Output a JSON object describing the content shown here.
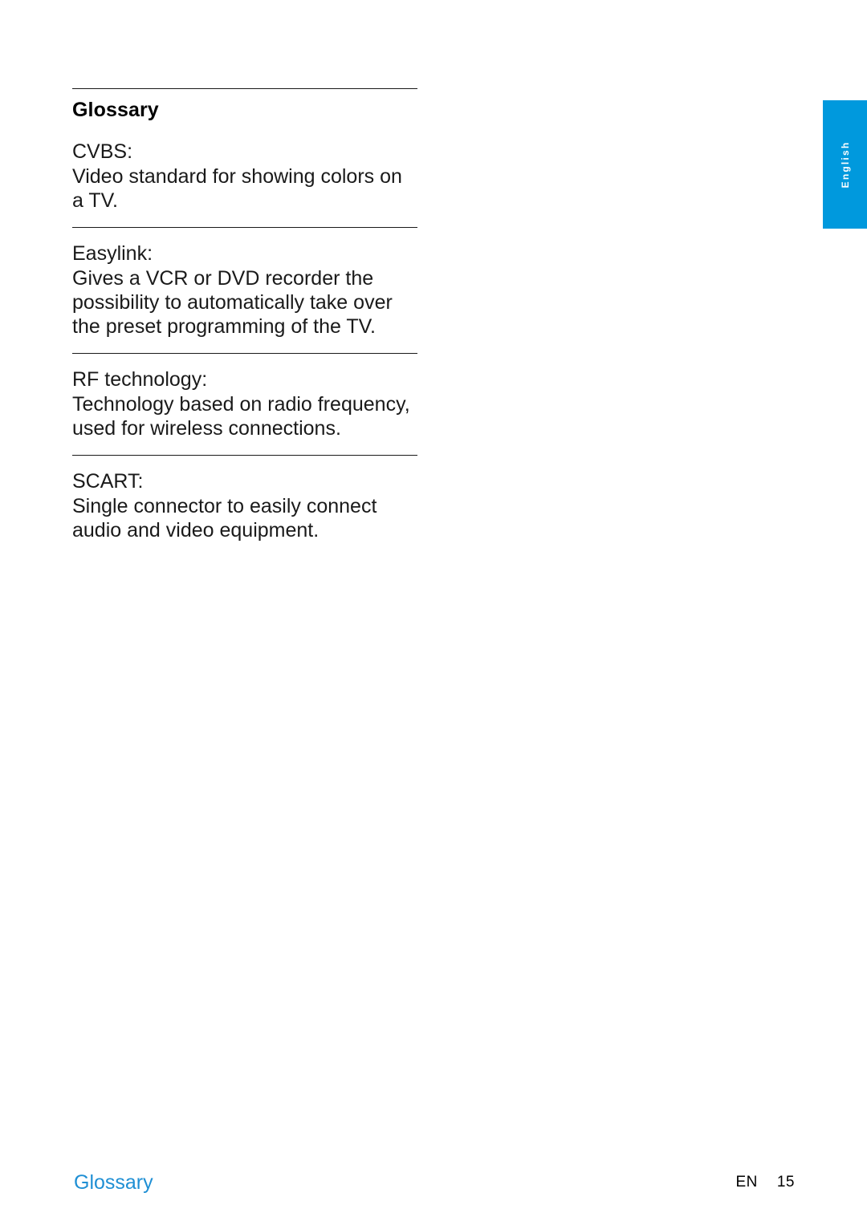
{
  "page": {
    "language_tab": "English",
    "section_title": "Glossary",
    "footer_chapter": "Glossary",
    "footer_lang_code": "EN",
    "footer_page_number": "15",
    "accent_color": "#0099dd",
    "link_color": "#1f8fd4"
  },
  "glossary": {
    "entries": [
      {
        "term": "CVBS:",
        "definition": "Video standard for showing colors on a TV."
      },
      {
        "term": "Easylink:",
        "definition": "Gives a VCR or DVD recorder the possibility to automatically take over the preset programming of the TV."
      },
      {
        "term": "RF technology:",
        "definition": "Technology based on radio frequency, used for wireless connections."
      },
      {
        "term": "SCART:",
        "definition": "Single connector to easily connect audio and video equipment."
      }
    ]
  }
}
